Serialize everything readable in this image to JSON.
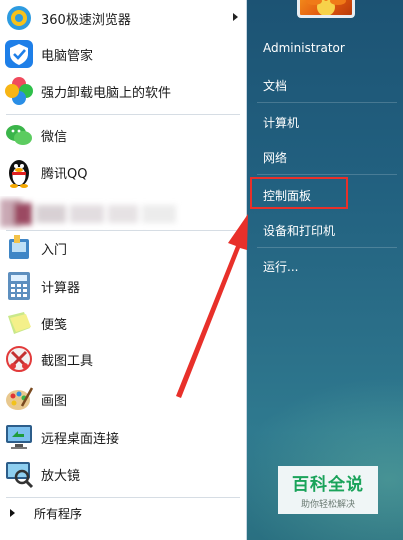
{
  "programs": [
    {
      "label": "360极速浏览器",
      "icon": "360-browser-icon",
      "has_submenu": true
    },
    {
      "label": "电脑管家",
      "icon": "pc-manager-icon"
    },
    {
      "label": "强力卸载电脑上的软件",
      "icon": "uninstaller-icon"
    },
    {
      "label": "微信",
      "icon": "wechat-icon"
    },
    {
      "label": "腾讯QQ",
      "icon": "qq-penguin-icon"
    },
    {
      "label": "入门",
      "icon": "getting-started-icon",
      "has_submenu": true
    },
    {
      "label": "计算器",
      "icon": "calculator-icon"
    },
    {
      "label": "便笺",
      "icon": "sticky-notes-icon"
    },
    {
      "label": "截图工具",
      "icon": "snipping-tool-icon"
    },
    {
      "label": "画图",
      "icon": "paint-icon"
    },
    {
      "label": "远程桌面连接",
      "icon": "remote-desktop-icon"
    },
    {
      "label": "放大镜",
      "icon": "magnifier-icon"
    }
  ],
  "all_programs": "所有程序",
  "right_panel": {
    "user": "Administrator",
    "items": [
      "文档",
      "计算机",
      "网络",
      "控制面板",
      "设备和打印机",
      "运行..."
    ],
    "highlighted": "控制面板"
  },
  "watermark": {
    "title": "百科全说",
    "subtitle": "助你轻松解决"
  },
  "colors": {
    "accent_red": "#e8302a",
    "panel_blue": "#226180",
    "watermark_green": "#1aa35a"
  }
}
